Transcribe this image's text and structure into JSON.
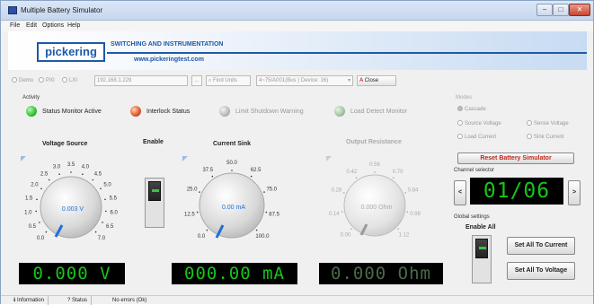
{
  "window": {
    "title": "Multiple Battery Simulator",
    "min": "−",
    "max": "□",
    "close": "✕"
  },
  "menu": [
    "File",
    "Edit",
    "Options",
    "Help"
  ],
  "banner": {
    "logo": "pickering",
    "title": "SWITCHING AND INSTRUMENTATION",
    "url": "www.pickeringtest.com"
  },
  "toolbar": {
    "demo": "Demo",
    "pxi": "PXI",
    "lxi": "LXI",
    "ip_value": "192.168.1.229",
    "dots": "...",
    "find_units": "Find Units",
    "device_select": "4~75/A001(Bus   ) Device: 16)",
    "close_label": "Close"
  },
  "activity": {
    "label": "Activity",
    "indicators": [
      {
        "label": "Status Monitor Active",
        "color": "#3cc43c"
      },
      {
        "label": "Interlock Status",
        "color": "#e06030"
      },
      {
        "label": "Limit Shutdown Warning",
        "color": "#bdbdbd"
      },
      {
        "label": "Load Detect Monitor",
        "color": "#a6c8a6"
      }
    ]
  },
  "mode": {
    "label": "Modes",
    "options": [
      {
        "label": "Cascade",
        "selected": true
      },
      {
        "label": "Source Voltage",
        "selected": false
      },
      {
        "label": "Sense Voltage",
        "selected": false
      },
      {
        "label": "Load Current",
        "selected": false
      },
      {
        "label": "Sink Current",
        "selected": false
      }
    ]
  },
  "voltage": {
    "title": "Voltage Source",
    "ticks": [
      "0.0",
      "0.5",
      "1.0",
      "1.5",
      "2.0",
      "2.5",
      "3.0",
      "3.5",
      "4.0",
      "4.5",
      "5.0",
      "5.5",
      "6.0",
      "6.5",
      "7.0"
    ],
    "value": "0.003 V",
    "lcd": "0.000 V"
  },
  "enable": {
    "title": "Enable"
  },
  "current": {
    "title": "Current Sink",
    "ticks": [
      "0.0",
      "12.5",
      "25.0",
      "37.5",
      "50.0",
      "62.5",
      "75.0",
      "87.5",
      "100.0"
    ],
    "value": "0.00 mA",
    "lcd": "000.00 mA"
  },
  "resistance": {
    "title": "Output Resistance",
    "ticks": [
      "0.00",
      "0.14",
      "0.28",
      "0.42",
      "0.56",
      "0.70",
      "0.84",
      "0.98",
      "1.12"
    ],
    "value": "0.000 Ohm",
    "lcd": "0.000 Ohm"
  },
  "right": {
    "reset": "Reset Battery Simulator",
    "channel_label": "Channel selector",
    "channel_value": "01/06",
    "prev": "<",
    "next": ">",
    "global_label": "Global settings",
    "enable_all": "Enable All",
    "set_current": "Set All To Current",
    "set_voltage": "Set All To Voltage"
  },
  "statusbar": {
    "tab1": "Information",
    "tab2": "Status",
    "message": "No errors (Ok)"
  }
}
